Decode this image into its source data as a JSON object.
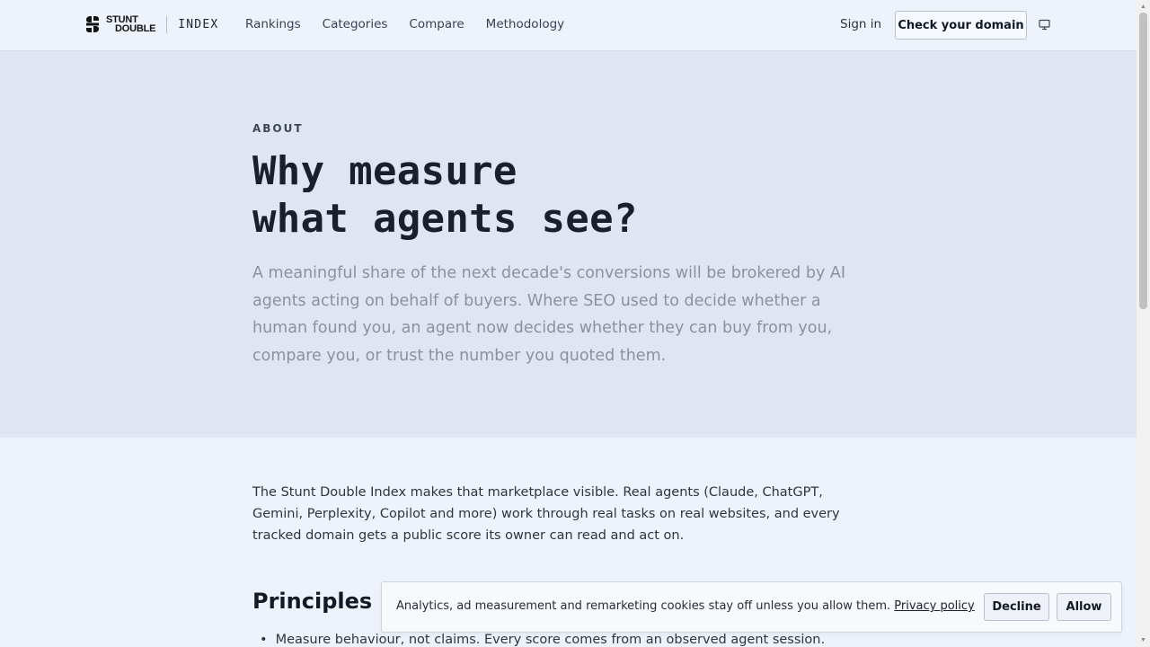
{
  "header": {
    "brand_line1": "STUNT",
    "brand_line2": "DOUBLE",
    "brand_suffix": "INDEX",
    "nav": [
      "Rankings",
      "Categories",
      "Compare",
      "Methodology"
    ],
    "sign_in": "Sign in",
    "cta": "Check your domain",
    "display_icon": "monitor-icon"
  },
  "hero": {
    "eyebrow": "ABOUT",
    "title_line1": "Why measure",
    "title_line2": "what agents see?",
    "lede": "A meaningful share of the next decade's conversions will be brokered by AI agents acting on behalf of buyers. Where SEO used to decide whether a human found you, an agent now decides whether they can buy from you, compare you, or trust the number you quoted them."
  },
  "body": {
    "intro": "The Stunt Double Index makes that marketplace visible. Real agents (Claude, ChatGPT, Gemini, Perplexity, Copilot and more) work through real tasks on real websites, and every tracked domain gets a public score its owner can read and act on.",
    "principles_heading": "Principles",
    "principles": [
      "Measure behaviour, not claims. Every score comes from an observed agent session."
    ]
  },
  "cookie": {
    "text": "Analytics, ad measurement and remarketing cookies stay off unless you allow them.",
    "link": "Privacy policy",
    "decline": "Decline",
    "allow": "Allow"
  },
  "colors": {
    "header_bg": "#eef3fb",
    "hero_bg": "#dfe6f1",
    "page_bg": "#eef3fb",
    "lede_text": "#8a929f"
  }
}
